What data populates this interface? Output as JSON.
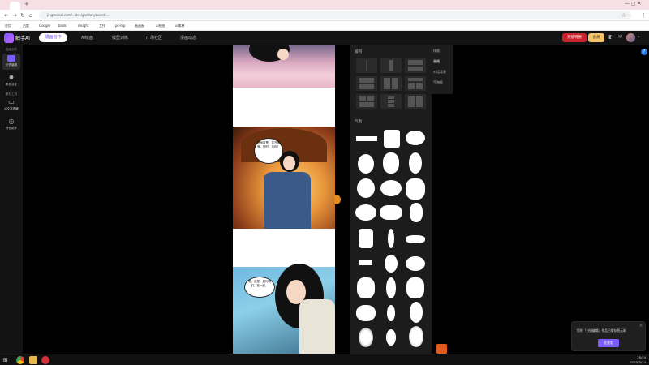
{
  "browser": {
    "url": "jingmanai.com/...design/storyboard/...",
    "bookmarks": [
      "应用",
      "百度",
      "Google",
      "book",
      "insight",
      "工作",
      "ps-mp",
      "画画板",
      "ai绘图",
      "ui素材"
    ]
  },
  "app": {
    "logo_text": "触手AI",
    "nav": {
      "active": "漫画创作",
      "items": [
        "AI绘画",
        "模型训练",
        "广场社区",
        "漫画动态"
      ]
    },
    "recharge_label": "充值特惠",
    "vip_label": "会员",
    "help_label": "?"
  },
  "sidebar": {
    "section1": "漫画创作",
    "items": [
      {
        "label": "分镜编辑",
        "icon": "edit-icon"
      },
      {
        "label": "角色设定",
        "icon": "character-icon"
      }
    ],
    "section2": "素材工具",
    "items2": [
      {
        "label": "AI文字理解",
        "icon": "text-icon"
      },
      {
        "label": "分镜助手",
        "icon": "assistant-icon"
      }
    ]
  },
  "canvas": {
    "bubble1": "世间若是，花开花落，何时，与你？",
    "bubble2": "嗯，我是，如何我们，在一起。"
  },
  "right_panel": {
    "layout_title": "排列",
    "shape_title": "气泡"
  },
  "right_tabs": [
    "排版",
    "画格",
    "对话背景",
    "气泡框"
  ],
  "toast": {
    "text": "您的「分镜编辑」作品已保存到云端",
    "button": "去查看",
    "close": "×"
  },
  "taskbar": {
    "time": "18:54",
    "date": "2025/3/14"
  }
}
